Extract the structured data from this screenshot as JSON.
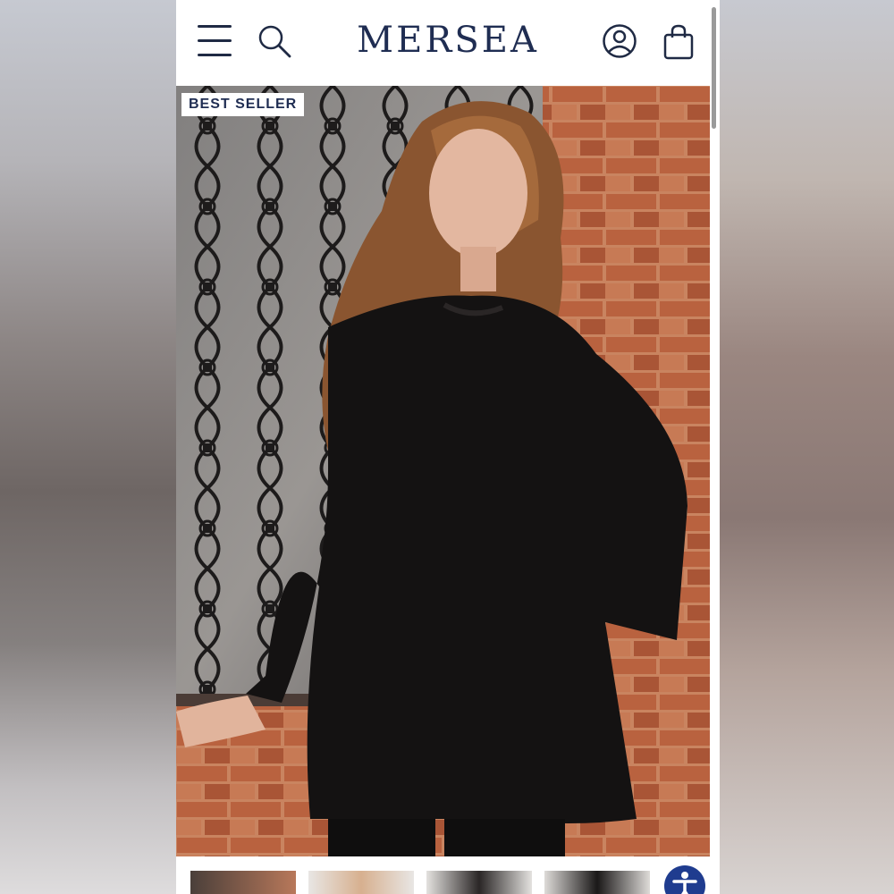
{
  "header": {
    "brand": "MERSEA",
    "menu_icon": "hamburger-menu-icon",
    "search_icon": "search-icon",
    "account_icon": "account-icon",
    "bag_icon": "shopping-bag-icon"
  },
  "hero": {
    "badge": "BEST SELLER",
    "image": "model-wearing-black-oversized-sweater"
  },
  "thumbnails": [
    {
      "image": "thumbnail-1"
    },
    {
      "image": "thumbnail-2"
    },
    {
      "image": "thumbnail-3"
    },
    {
      "image": "thumbnail-4"
    }
  ],
  "accessibility": {
    "icon": "accessibility-icon"
  },
  "colors": {
    "brand": "#1f2d52",
    "accent": "#1f3c8f"
  }
}
